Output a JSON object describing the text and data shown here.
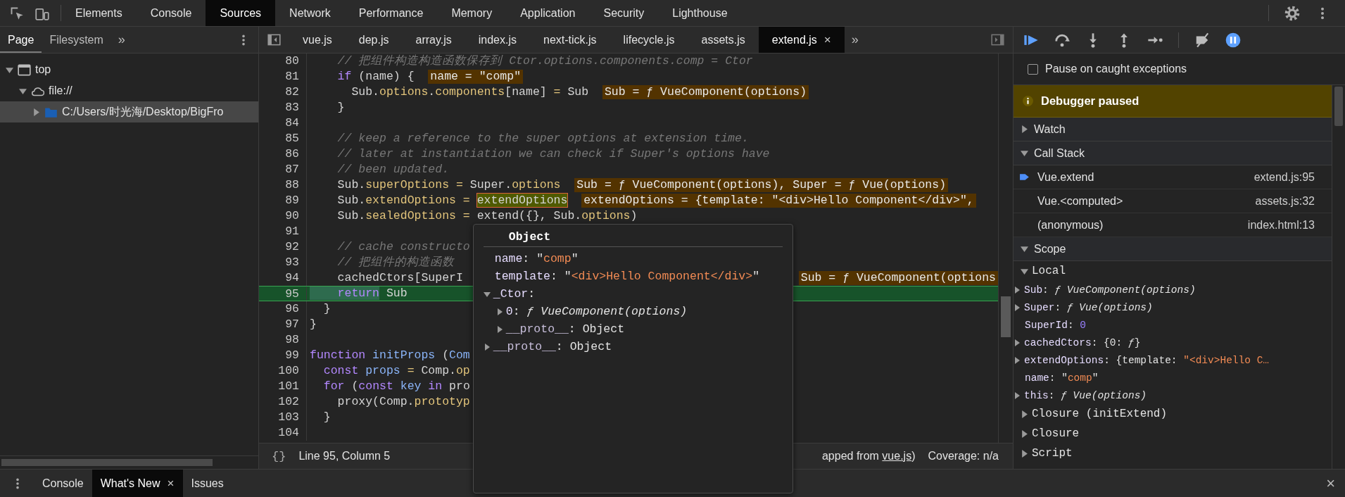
{
  "main_tabs": [
    {
      "label": "Elements",
      "selected": false
    },
    {
      "label": "Console",
      "selected": false
    },
    {
      "label": "Sources",
      "selected": true
    },
    {
      "label": "Network",
      "selected": false
    },
    {
      "label": "Performance",
      "selected": false
    },
    {
      "label": "Memory",
      "selected": false
    },
    {
      "label": "Application",
      "selected": false
    },
    {
      "label": "Security",
      "selected": false
    },
    {
      "label": "Lighthouse",
      "selected": false
    }
  ],
  "navigator": {
    "tabs": [
      {
        "label": "Page",
        "selected": true
      },
      {
        "label": "Filesystem",
        "selected": false
      }
    ],
    "more": "»",
    "tree": [
      {
        "label": "top",
        "kind": "window",
        "expanded": true,
        "selected": false,
        "children": [
          {
            "label": "file://",
            "kind": "cloud",
            "expanded": true,
            "selected": false,
            "children": [
              {
                "label": "C:/Users/时光海/Desktop/BigFro",
                "kind": "folder",
                "expanded": false,
                "selected": true
              }
            ]
          }
        ]
      }
    ]
  },
  "editor": {
    "tabs": [
      {
        "label": "vue.js",
        "selected": false
      },
      {
        "label": "dep.js",
        "selected": false
      },
      {
        "label": "array.js",
        "selected": false
      },
      {
        "label": "index.js",
        "selected": false
      },
      {
        "label": "next-tick.js",
        "selected": false
      },
      {
        "label": "lifecycle.js",
        "selected": false
      },
      {
        "label": "assets.js",
        "selected": false
      },
      {
        "label": "extend.js",
        "selected": true,
        "close": "×"
      }
    ],
    "more": "»",
    "lines": [
      {
        "number": "80",
        "current": false,
        "tokens": [
          {
            "text": "    // 把组件构造构造函数保存到 Ctor.options.components.comp = Ctor",
            "kind": "comment"
          }
        ]
      },
      {
        "number": "81",
        "current": false,
        "tokens": [
          {
            "text": "    if",
            "kind": "keyword"
          },
          {
            "text": " (name) {",
            "kind": "plain"
          }
        ],
        "inline_value": {
          "text": "name = \"comp\"",
          "kind": "after"
        }
      },
      {
        "number": "82",
        "current": false,
        "tokens": [
          {
            "text": "      Sub.",
            "kind": "plain"
          },
          {
            "text": "options",
            "kind": "prop"
          },
          {
            "text": ".",
            "kind": "plain"
          },
          {
            "text": "components",
            "kind": "prop"
          },
          {
            "text": "[name] ",
            "kind": "plain"
          },
          {
            "text": "=",
            "kind": "op"
          },
          {
            "text": " Sub",
            "kind": "plain"
          }
        ],
        "inline_value": {
          "text": "Sub = ƒ VueComponent(options)",
          "kind": "after"
        }
      },
      {
        "number": "83",
        "current": false,
        "tokens": [
          {
            "text": "    }",
            "kind": "plain"
          }
        ]
      },
      {
        "number": "84",
        "current": false
      },
      {
        "number": "85",
        "current": false,
        "tokens": [
          {
            "text": "    // keep a reference to the super options at extension time.",
            "kind": "comment"
          }
        ]
      },
      {
        "number": "86",
        "current": false,
        "tokens": [
          {
            "text": "    // later at instantiation we can check if Super's options have",
            "kind": "comment"
          }
        ]
      },
      {
        "number": "87",
        "current": false,
        "tokens": [
          {
            "text": "    // been updated.",
            "kind": "comment"
          }
        ]
      },
      {
        "number": "88",
        "current": false,
        "tokens": [
          {
            "text": "    Sub.",
            "kind": "plain"
          },
          {
            "text": "superOptions",
            "kind": "prop"
          },
          {
            "text": " =",
            "kind": "op"
          },
          {
            "text": " Super.",
            "kind": "plain"
          },
          {
            "text": "options",
            "kind": "prop"
          }
        ],
        "inline_value": {
          "text": "Sub = ƒ VueComponent(options), Super = ƒ Vue(options)",
          "kind": "after"
        }
      },
      {
        "number": "89",
        "current": false,
        "tokens": [
          {
            "text": "    Sub.",
            "kind": "plain"
          },
          {
            "text": "extendOptions",
            "kind": "prop"
          },
          {
            "text": " = ",
            "kind": "op"
          },
          {
            "text": "extendOptions",
            "kind": "hover"
          }
        ],
        "inline_value": {
          "text": "extendOptions = {template: \"<div>Hello Component</div>\",",
          "kind": "after"
        }
      },
      {
        "number": "90",
        "current": false,
        "tokens": [
          {
            "text": "    Sub.",
            "kind": "plain"
          },
          {
            "text": "sealedOptions",
            "kind": "prop"
          },
          {
            "text": " =",
            "kind": "op"
          },
          {
            "text": " extend({}, Sub.",
            "kind": "plain"
          },
          {
            "text": "options",
            "kind": "prop"
          },
          {
            "text": ")",
            "kind": "plain"
          }
        ]
      },
      {
        "number": "91",
        "current": false
      },
      {
        "number": "92",
        "current": false,
        "tokens": [
          {
            "text": "    // cache constructo",
            "kind": "comment"
          }
        ]
      },
      {
        "number": "93",
        "current": false,
        "tokens": [
          {
            "text": "    // 把组件的构造函数",
            "kind": "comment"
          }
        ]
      },
      {
        "number": "94",
        "current": false,
        "tokens": [
          {
            "text": "    cachedCtors[SuperI",
            "kind": "plain"
          }
        ],
        "inline_value": {
          "text": "Sub = ƒ VueComponent(options",
          "kind": "end"
        }
      },
      {
        "number": "95",
        "current": true,
        "tokens": [
          {
            "text": "    return",
            "kind": "step"
          },
          {
            "text": " Sub",
            "kind": "plain"
          }
        ]
      },
      {
        "number": "96",
        "current": false,
        "tokens": [
          {
            "text": "  }",
            "kind": "plain"
          }
        ]
      },
      {
        "number": "97",
        "current": false,
        "tokens": [
          {
            "text": "}",
            "kind": "plain"
          }
        ]
      },
      {
        "number": "98",
        "current": false
      },
      {
        "number": "99",
        "current": false,
        "tokens": [
          {
            "text": "function",
            "kind": "keyword"
          },
          {
            "text": " initProps",
            "kind": "def"
          },
          {
            "text": " (",
            "kind": "plain"
          },
          {
            "text": "Com",
            "kind": "def"
          }
        ]
      },
      {
        "number": "100",
        "current": false,
        "tokens": [
          {
            "text": "  const",
            "kind": "keyword"
          },
          {
            "text": " props",
            "kind": "def"
          },
          {
            "text": " =",
            "kind": "op"
          },
          {
            "text": " Comp.",
            "kind": "plain"
          },
          {
            "text": "op",
            "kind": "prop"
          }
        ]
      },
      {
        "number": "101",
        "current": false,
        "tokens": [
          {
            "text": "  for",
            "kind": "keyword"
          },
          {
            "text": " (",
            "kind": "plain"
          },
          {
            "text": "const",
            "kind": "keyword"
          },
          {
            "text": " key",
            "kind": "def"
          },
          {
            "text": " in",
            "kind": "keyword"
          },
          {
            "text": " pro",
            "kind": "plain"
          }
        ]
      },
      {
        "number": "102",
        "current": false,
        "tokens": [
          {
            "text": "    proxy(Comp.",
            "kind": "plain"
          },
          {
            "text": "prototyp",
            "kind": "prop"
          }
        ]
      },
      {
        "number": "103",
        "current": false,
        "tokens": [
          {
            "text": "  }",
            "kind": "plain"
          }
        ]
      },
      {
        "number": "104",
        "current": false
      }
    ],
    "popup": {
      "title": "Object",
      "items": [
        {
          "parts": [
            {
              "text": "name",
              "kind": "key"
            },
            {
              "text": ": \"",
              "kind": "plain"
            },
            {
              "text": "comp",
              "kind": "string"
            },
            {
              "text": "\"",
              "kind": "plain"
            }
          ]
        },
        {
          "parts": [
            {
              "text": "template",
              "kind": "key"
            },
            {
              "text": ": \"",
              "kind": "plain"
            },
            {
              "text": "<div>Hello Component</div>",
              "kind": "string"
            },
            {
              "text": "\"",
              "kind": "plain"
            }
          ]
        },
        {
          "expanded": true,
          "parts": [
            {
              "text": "_Ctor",
              "kind": "key"
            },
            {
              "text": ":",
              "kind": "plain"
            }
          ],
          "children": [
            {
              "expanded": false,
              "parts": [
                {
                  "text": "0",
                  "kind": "key"
                },
                {
                  "text": ": ",
                  "kind": "plain"
                },
                {
                  "text": "ƒ VueComponent(options)",
                  "kind": "function"
                }
              ]
            },
            {
              "expanded": false,
              "parts": [
                {
                  "text": "__proto__",
                  "kind": "faded"
                },
                {
                  "text": ": Object",
                  "kind": "plain"
                }
              ]
            }
          ]
        },
        {
          "expanded": false,
          "parts": [
            {
              "text": "__proto__",
              "kind": "faded"
            },
            {
              "text": ": Object",
              "kind": "plain"
            }
          ]
        }
      ]
    },
    "status": {
      "format": "{}",
      "position": "Line 95, Column 5",
      "source_before": "apped from ",
      "source_link": "vue.js",
      "source_after": ")",
      "coverage": "Coverage: n/a"
    }
  },
  "debugger": {
    "pause_on_exceptions": true,
    "caught": {
      "label": "Pause on caught exceptions",
      "checked": false
    },
    "banner": "Debugger paused",
    "sections": [
      {
        "title": "Watch",
        "expanded": false
      },
      {
        "title": "Call Stack",
        "expanded": true,
        "frames": [
          {
            "name": "Vue.extend",
            "location": "extend.js:95",
            "current": true
          },
          {
            "name": "Vue.<computed>",
            "location": "assets.js:32",
            "current": false
          },
          {
            "name": "(anonymous)",
            "location": "index.html:13",
            "current": false
          }
        ]
      },
      {
        "title": "Scope",
        "expanded": true,
        "scopes": [
          {
            "label": "Local",
            "expanded": true,
            "children": [
              {
                "expanded": false,
                "parts": [
                  {
                    "text": "Sub",
                    "kind": "key"
                  },
                  {
                    "text": ": ",
                    "kind": "plain"
                  },
                  {
                    "text": "ƒ VueComponent(options)",
                    "kind": "function"
                  }
                ]
              },
              {
                "expanded": false,
                "parts": [
                  {
                    "text": "Super",
                    "kind": "key"
                  },
                  {
                    "text": ": ",
                    "kind": "plain"
                  },
                  {
                    "text": "ƒ Vue(options)",
                    "kind": "function"
                  }
                ]
              },
              {
                "parts": [
                  {
                    "text": "SuperId",
                    "kind": "key"
                  },
                  {
                    "text": ": ",
                    "kind": "plain"
                  },
                  {
                    "text": "0",
                    "kind": "number"
                  }
                ]
              },
              {
                "expanded": false,
                "parts": [
                  {
                    "text": "cachedCtors",
                    "kind": "key"
                  },
                  {
                    "text": ": {0: ",
                    "kind": "plain"
                  },
                  {
                    "text": "ƒ",
                    "kind": "function"
                  },
                  {
                    "text": "}",
                    "kind": "plain"
                  }
                ]
              },
              {
                "expanded": false,
                "parts": [
                  {
                    "text": "extendOptions",
                    "kind": "key"
                  },
                  {
                    "text": ": {template: ",
                    "kind": "plain"
                  },
                  {
                    "text": "\"<div>Hello C…",
                    "kind": "string"
                  }
                ]
              },
              {
                "parts": [
                  {
                    "text": "name",
                    "kind": "key"
                  },
                  {
                    "text": ": \"",
                    "kind": "plain"
                  },
                  {
                    "text": "comp",
                    "kind": "string"
                  },
                  {
                    "text": "\"",
                    "kind": "plain"
                  }
                ]
              },
              {
                "expanded": false,
                "parts": [
                  {
                    "text": "this",
                    "kind": "key"
                  },
                  {
                    "text": ": ",
                    "kind": "plain"
                  },
                  {
                    "text": "ƒ Vue(options)",
                    "kind": "function"
                  }
                ]
              }
            ]
          },
          {
            "label": "Closure (initExtend)",
            "expanded": false
          },
          {
            "label": "Closure",
            "expanded": false
          },
          {
            "label": "Script",
            "expanded": false
          }
        ]
      }
    ]
  },
  "drawer": {
    "tabs": [
      {
        "label": "Console",
        "selected": false
      },
      {
        "label": "What's New",
        "selected": true,
        "close": "×"
      },
      {
        "label": "Issues",
        "selected": false
      }
    ],
    "close": "×"
  }
}
